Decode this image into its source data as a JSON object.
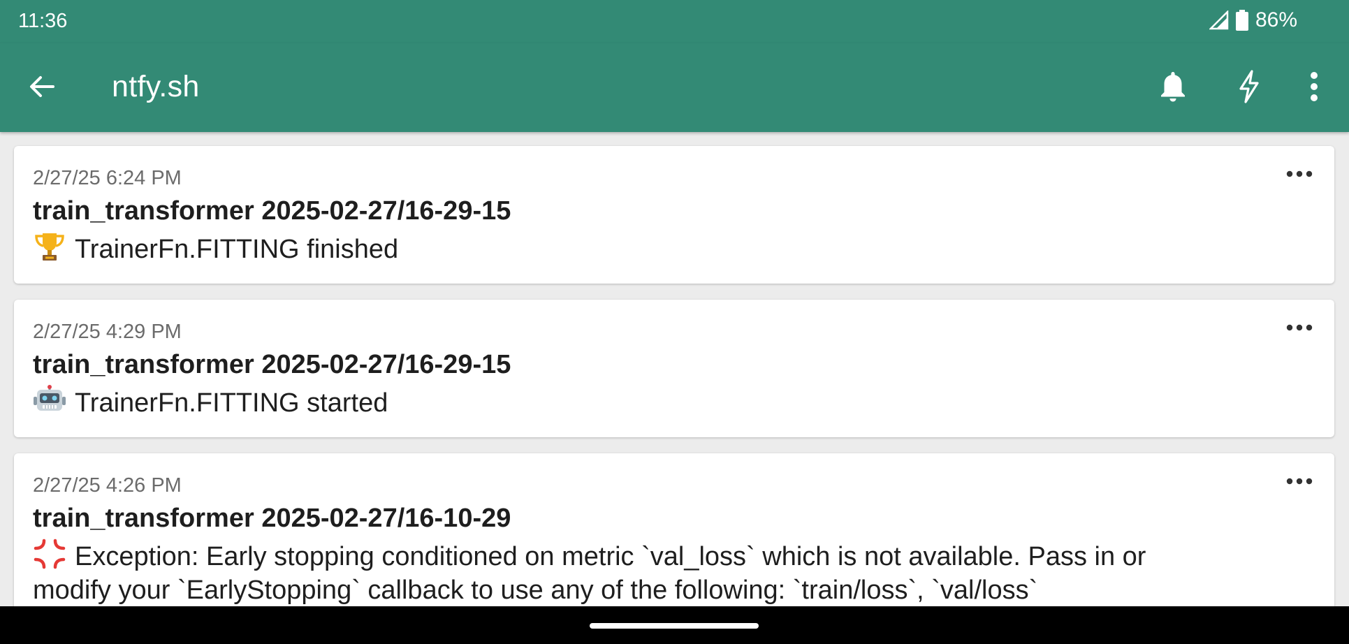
{
  "status_bar": {
    "time": "11:36",
    "battery_percent": "86%",
    "icons": [
      "signal-icon",
      "battery-icon"
    ]
  },
  "app_bar": {
    "title": "ntfy.sh",
    "back_icon": "arrow-back-icon",
    "actions": [
      "bell-icon",
      "lightning-icon",
      "more-vert-icon"
    ]
  },
  "colors": {
    "accent": "#338a75",
    "background": "#ececec",
    "card": "#ffffff",
    "timestamp": "#6b6b6b"
  },
  "notifications": [
    {
      "time": "2/27/25 6:24 PM",
      "title": "train_transformer 2025-02-27/16-29-15",
      "emoji": "trophy-icon",
      "message": "TrainerFn.FITTING finished"
    },
    {
      "time": "2/27/25 4:29 PM",
      "title": "train_transformer 2025-02-27/16-29-15",
      "emoji": "robot-icon",
      "message": "TrainerFn.FITTING started"
    },
    {
      "time": "2/27/25 4:26 PM",
      "title": "train_transformer 2025-02-27/16-10-29",
      "emoji": "anger-icon",
      "message": "Exception: Early stopping conditioned on metric `val_loss` which is not available. Pass in or modify your `EarlyStopping` callback to use any of the following: `train/loss`, `val/loss`"
    }
  ]
}
